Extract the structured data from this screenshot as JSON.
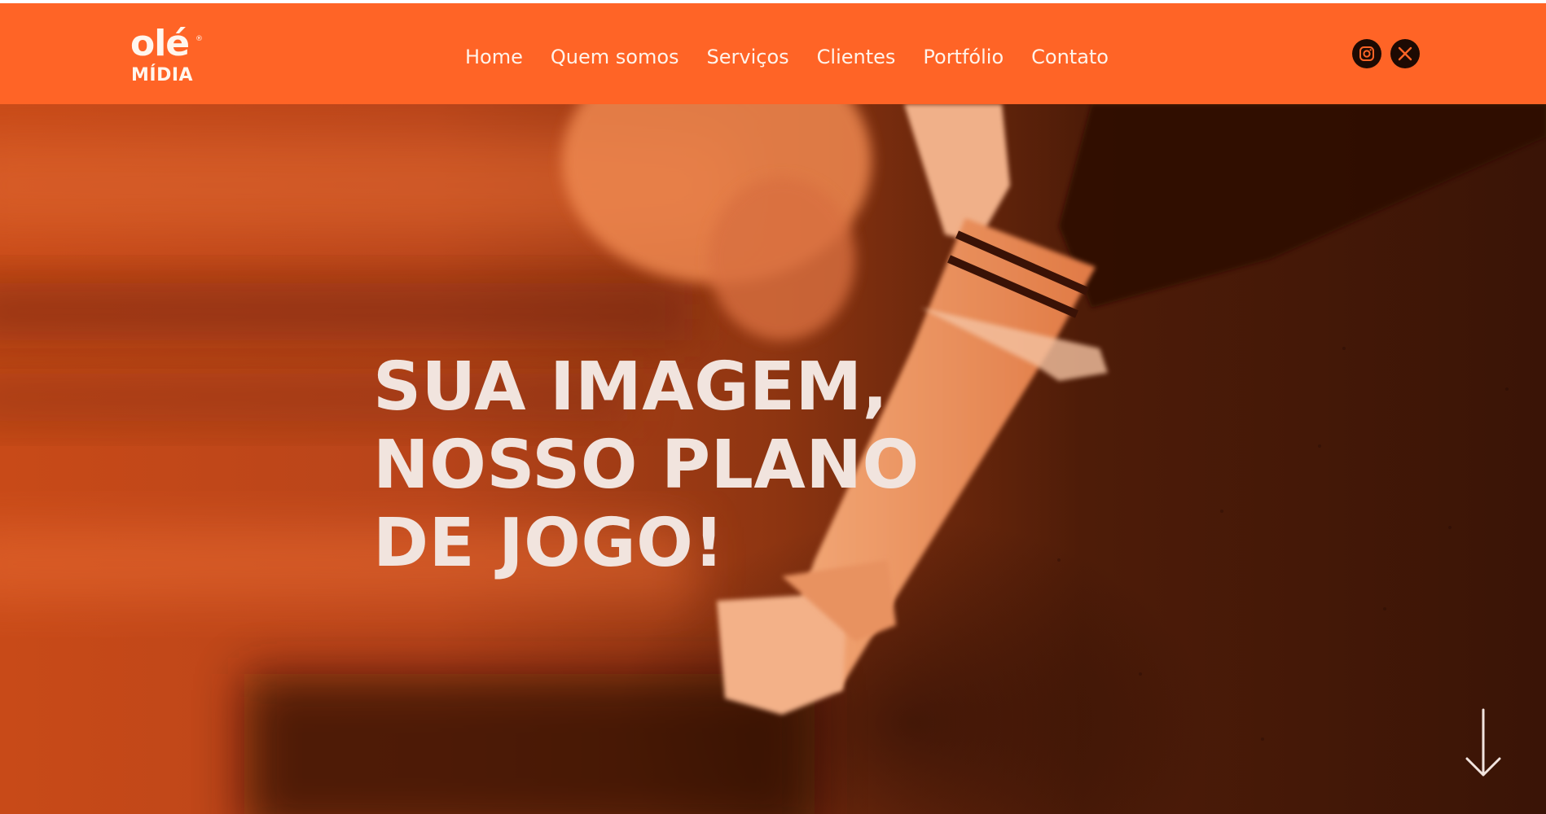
{
  "brand": {
    "logo_top": "olé",
    "logo_registered": "®",
    "logo_bottom": "MÍDIA",
    "primary_color": "#ff6426",
    "text_color": "#f1e4de",
    "dark_color": "#1d0a03"
  },
  "nav": {
    "items": [
      {
        "label": "Home"
      },
      {
        "label": "Quem somos"
      },
      {
        "label": "Serviços"
      },
      {
        "label": "Clientes"
      },
      {
        "label": "Portfólio"
      },
      {
        "label": "Contato"
      }
    ]
  },
  "social": [
    {
      "icon": "instagram-icon"
    },
    {
      "icon": "x-twitter-icon"
    }
  ],
  "hero": {
    "title_lines": [
      "SUA IMAGEM,",
      "NOSSO PLANO",
      "DE JOGO!"
    ],
    "scroll_icon": "arrow-down-icon"
  }
}
